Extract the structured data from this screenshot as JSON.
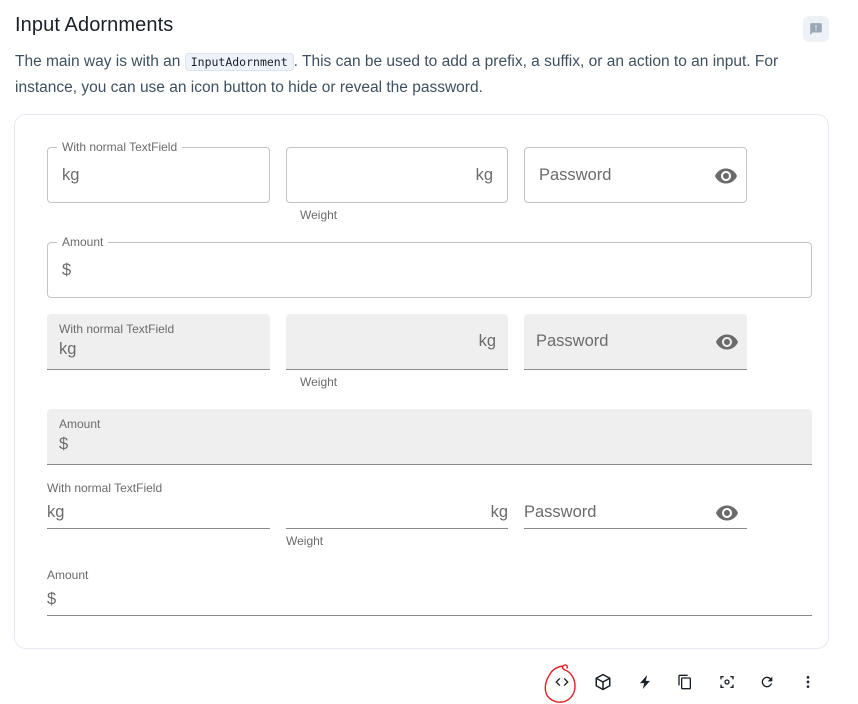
{
  "header": {
    "title": "Input Adornments",
    "feedback_icon": "feedback-icon"
  },
  "description": {
    "before": "The main way is with an ",
    "code": "InputAdornment",
    "after": ". This can be used to add a prefix, a suffix, or an action to an input. For instance, you can use an icon button to hide or reveal the password."
  },
  "outlined": {
    "field1": {
      "label": "With normal TextField",
      "adornment": "kg"
    },
    "field2": {
      "adornment": "kg",
      "helper": "Weight"
    },
    "field3": {
      "placeholder": "Password",
      "icon": "visibility-icon"
    },
    "amount": {
      "label": "Amount",
      "adornment": "$"
    }
  },
  "filled": {
    "field1": {
      "label": "With normal TextField",
      "adornment": "kg"
    },
    "field2": {
      "adornment": "kg",
      "helper": "Weight"
    },
    "field3": {
      "placeholder": "Password",
      "icon": "visibility-icon"
    },
    "amount": {
      "label": "Amount",
      "adornment": "$"
    }
  },
  "standard": {
    "field1": {
      "label": "With normal TextField",
      "adornment": "kg"
    },
    "field2": {
      "adornment": "kg",
      "helper": "Weight"
    },
    "field3": {
      "placeholder": "Password",
      "icon": "visibility-icon"
    },
    "amount": {
      "label": "Amount",
      "adornment": "$"
    }
  },
  "toolbar": {
    "icons": [
      "code-icon",
      "codesandbox-icon",
      "stackblitz-icon",
      "copy-icon",
      "reset-focus-icon",
      "reset-demo-icon",
      "more-icon"
    ]
  },
  "colors": {
    "icon": "#6b6b6b",
    "toolbar_icon": "#1a2027",
    "annotation": "#e02020",
    "border": "#c4c4c4",
    "filled_bg": "#efefef"
  }
}
